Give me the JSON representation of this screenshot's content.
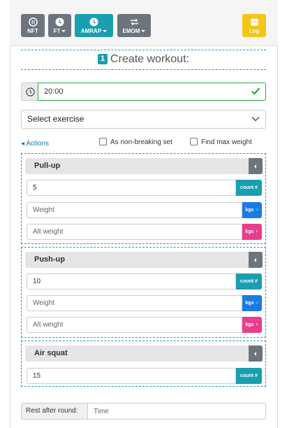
{
  "toolbar": {
    "buttons": [
      {
        "label": "NFT",
        "icon": "pause-circle-icon",
        "color": "#6c757d"
      },
      {
        "label": "FT",
        "icon": "clock-icon",
        "color": "#6c757d"
      },
      {
        "label": "AMRAP",
        "icon": "clock-icon",
        "color": "#1a9fb0"
      },
      {
        "label": "EMOM",
        "icon": "repeat-icon",
        "color": "#6c757d"
      }
    ],
    "log": {
      "label": "Log",
      "icon": "calendar-icon",
      "color": "#f5c516"
    }
  },
  "header": {
    "step": "1",
    "title": "Create workout:"
  },
  "timer": {
    "icon": "clock-icon",
    "value": "20:00",
    "status_icon": "check-icon"
  },
  "exercise_select": {
    "value": "Select exercise"
  },
  "actions_label": "Actions",
  "options": {
    "non_breaking": "As non-breaking set",
    "find_max": "Find max weight"
  },
  "exercises": [
    {
      "name": "Pull-up",
      "count": "5",
      "count_badge": "count #",
      "weight_placeholder": "Weight",
      "alt_weight_placeholder": "Alt weight",
      "kgs_badge": "kgs"
    },
    {
      "name": "Push-up",
      "count": "10",
      "count_badge": "count #",
      "weight_placeholder": "Weight",
      "alt_weight_placeholder": "Alt weight",
      "kgs_badge": "kgs"
    },
    {
      "name": "Air squat",
      "count": "15",
      "count_badge": "count #"
    }
  ],
  "rest": {
    "label": "Rest after round:",
    "placeholder": "Time"
  },
  "colors": {
    "accent": "#1a9fb0",
    "male": "#1b7be6",
    "female": "#e83e8c",
    "valid": "#28a745"
  }
}
